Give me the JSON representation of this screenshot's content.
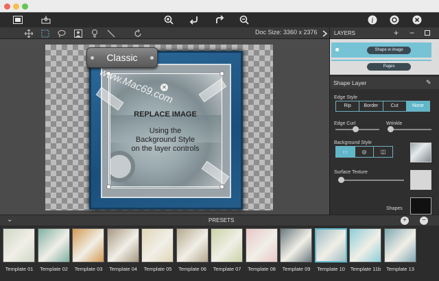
{
  "toolbar": {
    "icons": [
      "presets-icon",
      "inbox-icon",
      "zoom-in-icon",
      "undo-icon",
      "redo-icon",
      "zoom-out-icon",
      "info-icon",
      "settings-icon",
      "close-icon"
    ]
  },
  "tools": {
    "doc_size": "Doc Size: 3360 x 2376"
  },
  "canvas": {
    "plate_title": "Classic",
    "replace_title": "REPLACE IMAGE",
    "replace_lines": [
      "Using the",
      "Background Style",
      "on the layer controls"
    ],
    "watermark": "www.Mac69.com"
  },
  "layers_panel": {
    "title": "LAYERS",
    "items": [
      "Shape w image",
      "Pages"
    ]
  },
  "shape_layer": {
    "title": "Shape Layer",
    "edge_style_label": "Edge Style",
    "edge_styles": [
      "Rip",
      "Border",
      "Cut",
      "None"
    ],
    "selected_edge_style": "None",
    "edge_curl_label": "Edge Curl",
    "edge_curl": 0.45,
    "wrinkle_label": "Wrinkle",
    "wrinkle": 0.0,
    "background_style_label": "Background Style",
    "surface_texture_label": "Surface Texture",
    "surface_texture": 0.0,
    "shapes_label": "Shapes"
  },
  "presets": {
    "title": "PRESETS",
    "templates": [
      "Template 01",
      "Template 02",
      "Template 03",
      "Template 04",
      "Template 05",
      "Template 06",
      "Template 07",
      "Template 08",
      "Template 09",
      "Template 10",
      "Template 11b",
      "Template 13"
    ],
    "selected": "Template 10"
  },
  "colors": {
    "accent": "#5fb7c9",
    "toolbar": "#2b2b2b",
    "panel": "#2f2f2f"
  }
}
